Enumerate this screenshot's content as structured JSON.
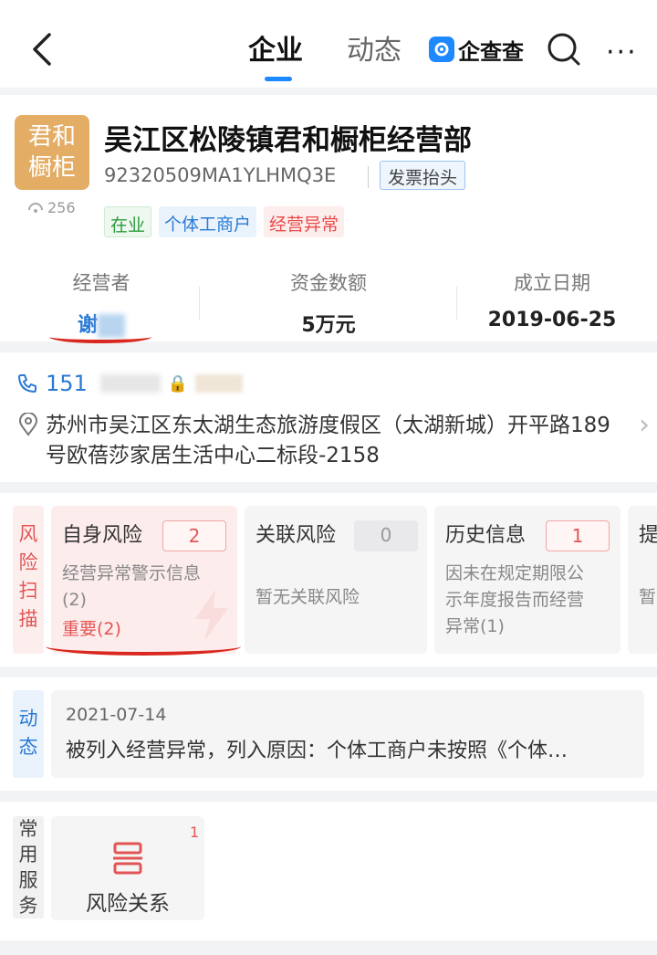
{
  "header": {
    "tabs": [
      {
        "label": "企业",
        "active": true
      },
      {
        "label": "动态",
        "active": false
      }
    ],
    "brand": "企查查",
    "accent_color": "#1e88ff"
  },
  "company": {
    "logo_text_line1": "君和",
    "logo_text_line2": "橱柜",
    "logo_color": "#e3ad66",
    "views": "256",
    "name": "吴江区松陵镇君和橱柜经营部",
    "credit_code": "92320509MA1YLHMQ3E",
    "invoice_button": "发票抬头",
    "tags": [
      "在业",
      "个体工商户",
      "经营异常"
    ],
    "stats": [
      {
        "label": "经营者",
        "value": "谢"
      },
      {
        "label": "资金数额",
        "value": "5万元"
      },
      {
        "label": "成立日期",
        "value": "2019-06-25"
      }
    ]
  },
  "contact": {
    "phone_prefix": "151",
    "address": "苏州市吴江区东太湖生态旅游度假区（太湖新城）开平路189号欧蓓莎家居生活中心二标段-2158"
  },
  "risk": {
    "side_label": [
      "风",
      "险",
      "扫",
      "描"
    ],
    "cards": [
      {
        "title": "自身风险",
        "count": "2",
        "desc_line1": "经营异常警示信息",
        "desc_line2": "(2)",
        "important": "重要(2)"
      },
      {
        "title": "关联风险",
        "count": "0",
        "desc_line1": "暂无关联风险"
      },
      {
        "title": "历史信息",
        "count": "1",
        "desc_line1": "因未在规定期限公",
        "desc_line2": "示年度报告而经营",
        "desc_line3": "异常(1)"
      },
      {
        "title": "提",
        "desc_line1": "暂"
      }
    ]
  },
  "dynamic": {
    "side_label": [
      "动",
      "态"
    ],
    "date": "2021-07-14",
    "text": "被列入经营异常，列入原因：个体工商户未按照《个体…"
  },
  "services": {
    "side_label": [
      "常",
      "用",
      "服",
      "务"
    ],
    "items": [
      {
        "label": "风险关系",
        "badge": "1",
        "icon": "risk-relation-icon"
      }
    ]
  }
}
